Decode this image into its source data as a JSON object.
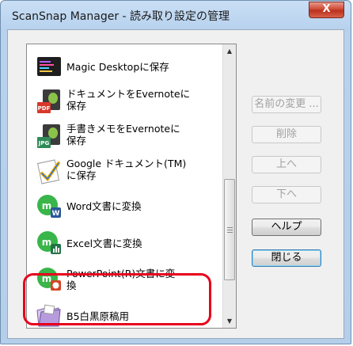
{
  "window": {
    "title": "ScanSnap Manager - 読み取り設定の管理",
    "close_glyph": "X"
  },
  "profiles": [
    {
      "label": "Magic Desktopに保存",
      "icon": "magic-desktop-icon"
    },
    {
      "label": "ドキュメントをEvernoteに\n保存",
      "icon": "evernote-pdf-icon"
    },
    {
      "label": "手書きメモをEvernoteに\n保存",
      "icon": "evernote-jpg-icon"
    },
    {
      "label": "Google ドキュメント(TM)\nに保存",
      "icon": "google-docs-icon"
    },
    {
      "label": "Word文書に変換",
      "icon": "word-convert-icon"
    },
    {
      "label": "Excel文書に変換",
      "icon": "excel-convert-icon"
    },
    {
      "label": "PowerPoint(R)文書に変\n換",
      "icon": "powerpoint-convert-icon"
    },
    {
      "label": "B5白黒原稿用",
      "icon": "folder-icon"
    }
  ],
  "buttons": {
    "rename": "名前の変更 ...",
    "delete": "削除",
    "up": "上へ",
    "down": "下へ",
    "help": "ヘルプ",
    "close": "閉じる"
  },
  "colors": {
    "highlight_border": "#e8001c",
    "title_bar": "#c9dff5",
    "client_bg": "#f0f0f0"
  }
}
